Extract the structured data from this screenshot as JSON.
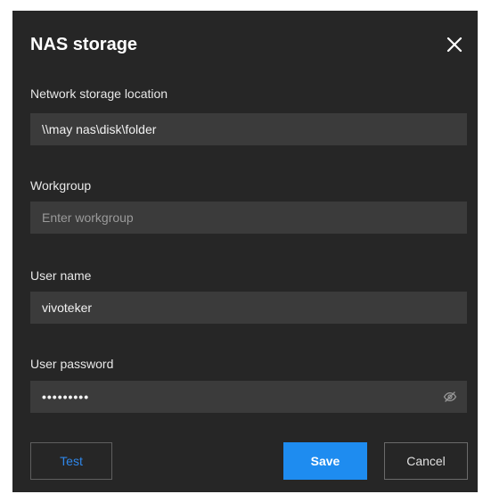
{
  "dialog": {
    "title": "NAS storage",
    "close_icon": "close-icon"
  },
  "fields": {
    "location": {
      "label": "Network storage location",
      "value": "\\\\may nas\\disk\\folder",
      "placeholder": ""
    },
    "workgroup": {
      "label": "Workgroup",
      "value": "",
      "placeholder": "Enter workgroup"
    },
    "username": {
      "label": "User name",
      "value": "vivoteker",
      "placeholder": ""
    },
    "password": {
      "label": "User password",
      "masked_value": "•••••••••",
      "visibility_icon": "eye-slash-icon"
    }
  },
  "buttons": {
    "test": "Test",
    "save": "Save",
    "cancel": "Cancel"
  },
  "colors": {
    "dialog_background": "#262626",
    "input_background": "#3b3b3b",
    "accent": "#1e8cf0",
    "test_text": "#2f87ea"
  }
}
